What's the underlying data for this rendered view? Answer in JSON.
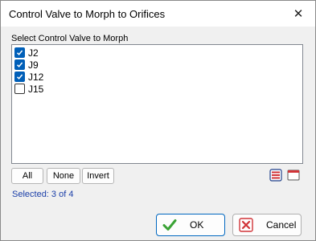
{
  "window": {
    "title": "Control Valve to Morph to Orifices",
    "close_glyph": "✕"
  },
  "list": {
    "label": "Select Control Valve to Morph",
    "items": [
      {
        "label": "J2",
        "checked": true
      },
      {
        "label": "J9",
        "checked": true
      },
      {
        "label": "J12",
        "checked": true
      },
      {
        "label": "J15",
        "checked": false
      }
    ]
  },
  "selection_buttons": {
    "all": "All",
    "none": "None",
    "invert": "Invert"
  },
  "view_icons": [
    "list-view-icon",
    "window-view-icon"
  ],
  "status": "Selected: 3 of 4",
  "actions": {
    "ok": "OK",
    "cancel": "Cancel"
  },
  "colors": {
    "accent": "#005fb8",
    "status_text": "#1a3ea8",
    "ok_green": "#3aa335",
    "cancel_red": "#d13438"
  }
}
